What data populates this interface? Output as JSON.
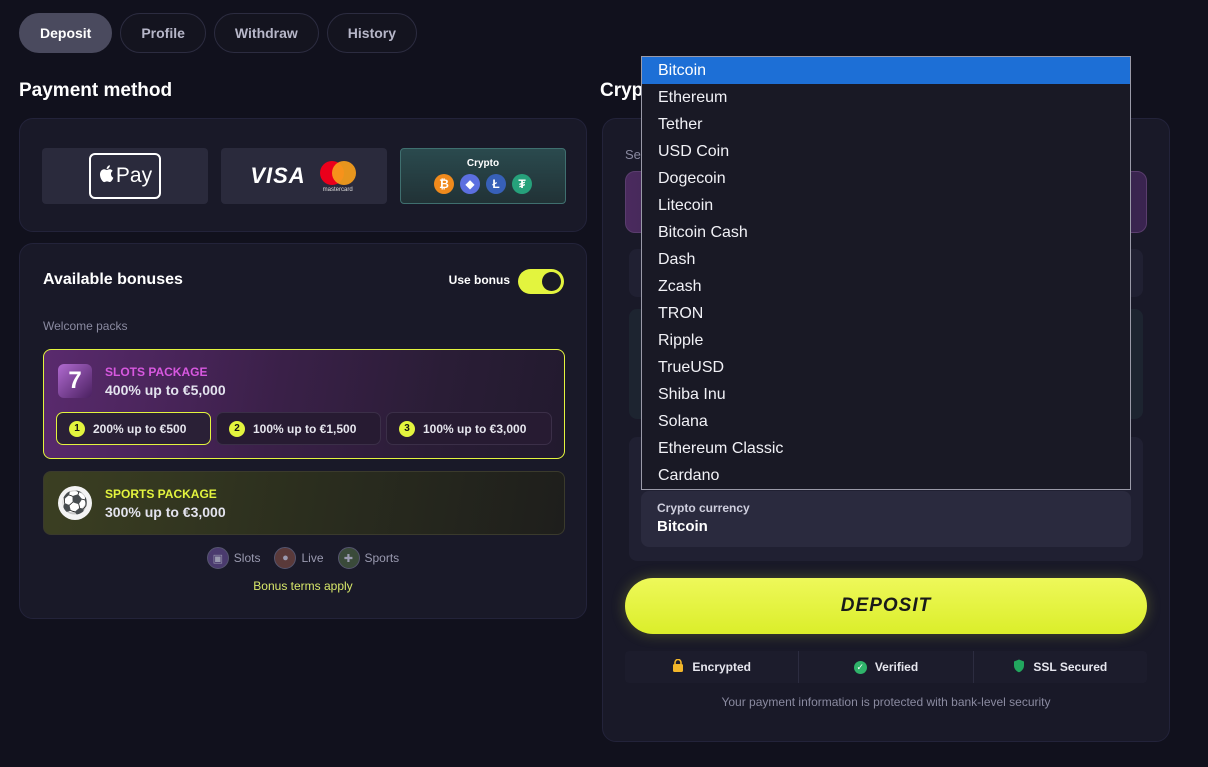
{
  "tabs": [
    {
      "label": "Deposit",
      "active": true
    },
    {
      "label": "Profile",
      "active": false
    },
    {
      "label": "Withdraw",
      "active": false
    },
    {
      "label": "History",
      "active": false
    }
  ],
  "payment_method": {
    "title": "Payment method",
    "applepay_label": "Pay",
    "visa_label": "VISA",
    "mastercard_label": "mastercard",
    "crypto_label": "Crypto",
    "crypto_coins": [
      "₿",
      "◆",
      "Ł",
      "₮"
    ]
  },
  "bonuses": {
    "title": "Available bonuses",
    "use_bonus_label": "Use bonus",
    "use_bonus_on": true,
    "welcome_label": "Welcome packs",
    "slots": {
      "name": "SLOTS PACKAGE",
      "desc": "400% up to €5,000",
      "options": [
        {
          "num": "1",
          "label": "200% up to €500",
          "selected": true
        },
        {
          "num": "2",
          "label": "100% up to €1,500",
          "selected": false
        },
        {
          "num": "3",
          "label": "100% up to €3,000",
          "selected": false
        }
      ]
    },
    "sports": {
      "name": "SPORTS PACKAGE",
      "desc": "300% up to €3,000"
    },
    "categories": [
      "Slots",
      "Live",
      "Sports"
    ],
    "terms": "Bonus terms apply"
  },
  "crypto_panel": {
    "title": "Cryp",
    "label_partial": "Se",
    "currency_label": "Crypto currency",
    "currency_value": "Bitcoin",
    "deposit_label": "DEPOSIT",
    "badges": [
      "Encrypted",
      "Verified",
      "SSL Secured"
    ],
    "secure_note": "Your payment information is protected with bank-level security"
  },
  "dropdown": {
    "highlighted": "Bitcoin",
    "options": [
      "Bitcoin",
      "Ethereum",
      "Tether",
      "USD Coin",
      "Dogecoin",
      "Litecoin",
      "Bitcoin Cash",
      "Dash",
      "Zcash",
      "TRON",
      "Ripple",
      "TrueUSD",
      "Shiba Inu",
      "Solana",
      "Ethereum Classic",
      "Cardano"
    ]
  },
  "colors": {
    "accent": "#e3f43e",
    "background": "#11111d",
    "panel": "#191928",
    "dropdown_highlight": "#1d6fd6"
  }
}
